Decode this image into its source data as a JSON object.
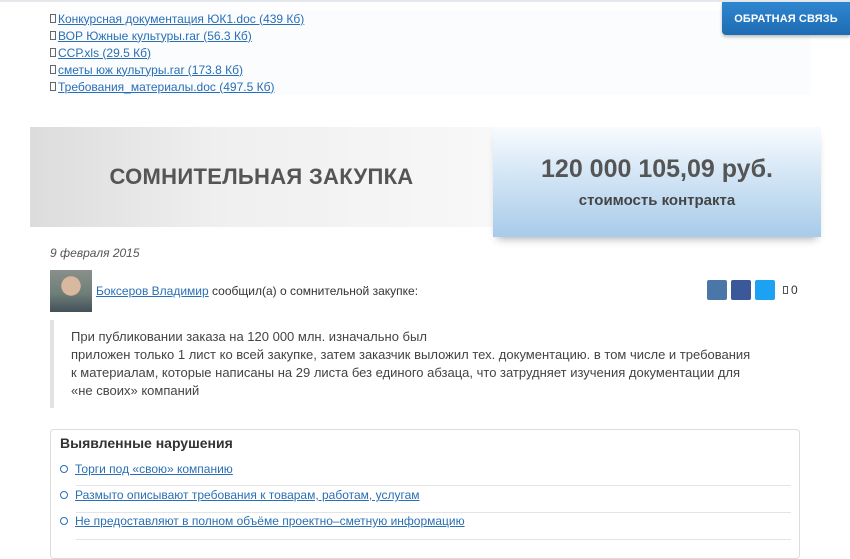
{
  "files": [
    {
      "label": "Конкурсная документация ЮК1.doc (439 Кб)"
    },
    {
      "label": "ВОР Южные культуры.rar (56.3 Кб)"
    },
    {
      "label": "ССР.xls (29.5 Кб)"
    },
    {
      "label": "сметы юж культуры.rar (173.8 Кб)"
    },
    {
      "label": "Требования_материалы.doc (497.5 Кб)"
    }
  ],
  "header": {
    "feedback_label": "ОБРАТНАЯ СВЯЗЬ"
  },
  "banner": {
    "title": "СОМНИТЕЛЬНАЯ ЗАКУПКА",
    "price": "120 000 105,09 руб.",
    "price_label": "стоимость контракта"
  },
  "report": {
    "date": "9 февраля 2015",
    "author": "Боксеров Владимир",
    "action": " сообщил(а) о сомнительной закупке:",
    "share_count": "0",
    "text_lines": [
      "При публиковании заказа на 120 000 млн. изначально был",
      "приложен только 1 лист ко всей закупке, затем заказчик выложил тех. документацию. в том числе и требования",
      "к материалам, которые написаны на 29 листа без единого абзаца, что затрудняет изучения документации для",
      "«не своих» компаний"
    ]
  },
  "violations": {
    "title": "Выявленные нарушения",
    "items": [
      {
        "label": "Торги под «свою» компанию"
      },
      {
        "label": "Размыто описывают требования к товарам, работам, услугам"
      },
      {
        "label": "Не предоставляют в полном объёме проектно–сметную информацию"
      }
    ]
  },
  "colors": {
    "link": "#2a6fb5",
    "accent": "#1e6cb3"
  }
}
